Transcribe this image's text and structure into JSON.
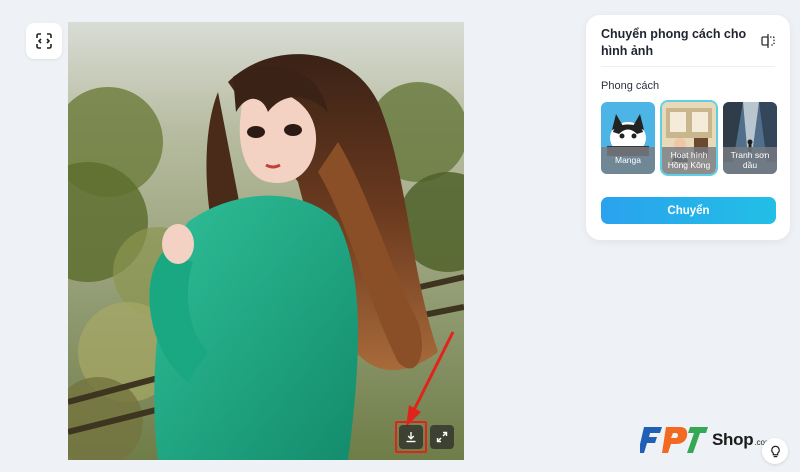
{
  "panel": {
    "title": "Chuyển phong cách cho hình ảnh",
    "section_label": "Phong cách",
    "styles": [
      {
        "label": "Manga",
        "selected": false
      },
      {
        "label": "Hoạt hình Hồng Kông",
        "selected": true
      },
      {
        "label": "Tranh sơn dầu",
        "selected": false
      }
    ],
    "convert_label": "Chuyển"
  },
  "icons": {
    "crop": "crop-scan-icon",
    "download": "download-icon",
    "fullscreen": "expand-icon",
    "compare": "compare-icon",
    "help": "lightbulb-icon"
  },
  "watermark": {
    "brand": "FPT",
    "shop": "Shop",
    "domain": ".com.vn"
  },
  "colors": {
    "accent": "#22b4ea",
    "highlight": "#e0241b",
    "selected_outline": "#5fd0e4"
  }
}
